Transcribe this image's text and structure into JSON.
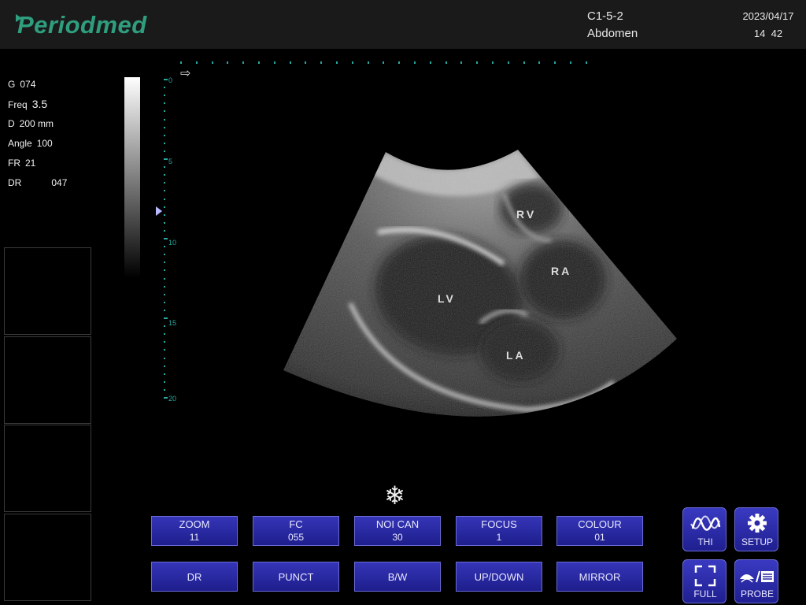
{
  "header": {
    "logo": "Periodmed",
    "probe": "C1-5-2",
    "preset": "Abdomen",
    "date": "2023/04/17",
    "time": "14  42"
  },
  "params": [
    {
      "key": "G",
      "value": "074"
    },
    {
      "key": "Freq",
      "value": "3.5"
    },
    {
      "key": "D",
      "value": "200 mm"
    },
    {
      "key": "Angle",
      "value": "100"
    },
    {
      "key": "FR",
      "value": "21"
    },
    {
      "key": "DR",
      "value": "047"
    }
  ],
  "depth_scale": [
    "0",
    "5",
    "10",
    "15",
    "20"
  ],
  "labels": {
    "rv": "RV",
    "ra": "RA",
    "lv": "LV",
    "la": "LA"
  },
  "buttons": {
    "zoom": {
      "label": "ZOOM",
      "value": "11"
    },
    "fc": {
      "label": "FC",
      "value": "055"
    },
    "noi_can": {
      "label": "NOI CAN",
      "value": "30"
    },
    "focus": {
      "label": "FOCUS",
      "value": "1"
    },
    "colour": {
      "label": "COLOUR",
      "value": "01"
    },
    "dr": "DR",
    "punct": "PUNCT",
    "bw": "B/W",
    "updown": "UP/DOWN",
    "mirror": "MIRROR",
    "thi": "THI",
    "setup": "SETUP",
    "full": "FULL",
    "probe": "PROBE"
  },
  "colors": {
    "brand": "#2f9e7e",
    "button": "#2a2aa8",
    "scale": "#2aa8a0"
  },
  "icons": {
    "freeze": "snowflake-icon",
    "thi": "harmonic-wave-icon",
    "setup": "gear-icon",
    "full": "fullscreen-icon",
    "probe": "probe-icon"
  }
}
